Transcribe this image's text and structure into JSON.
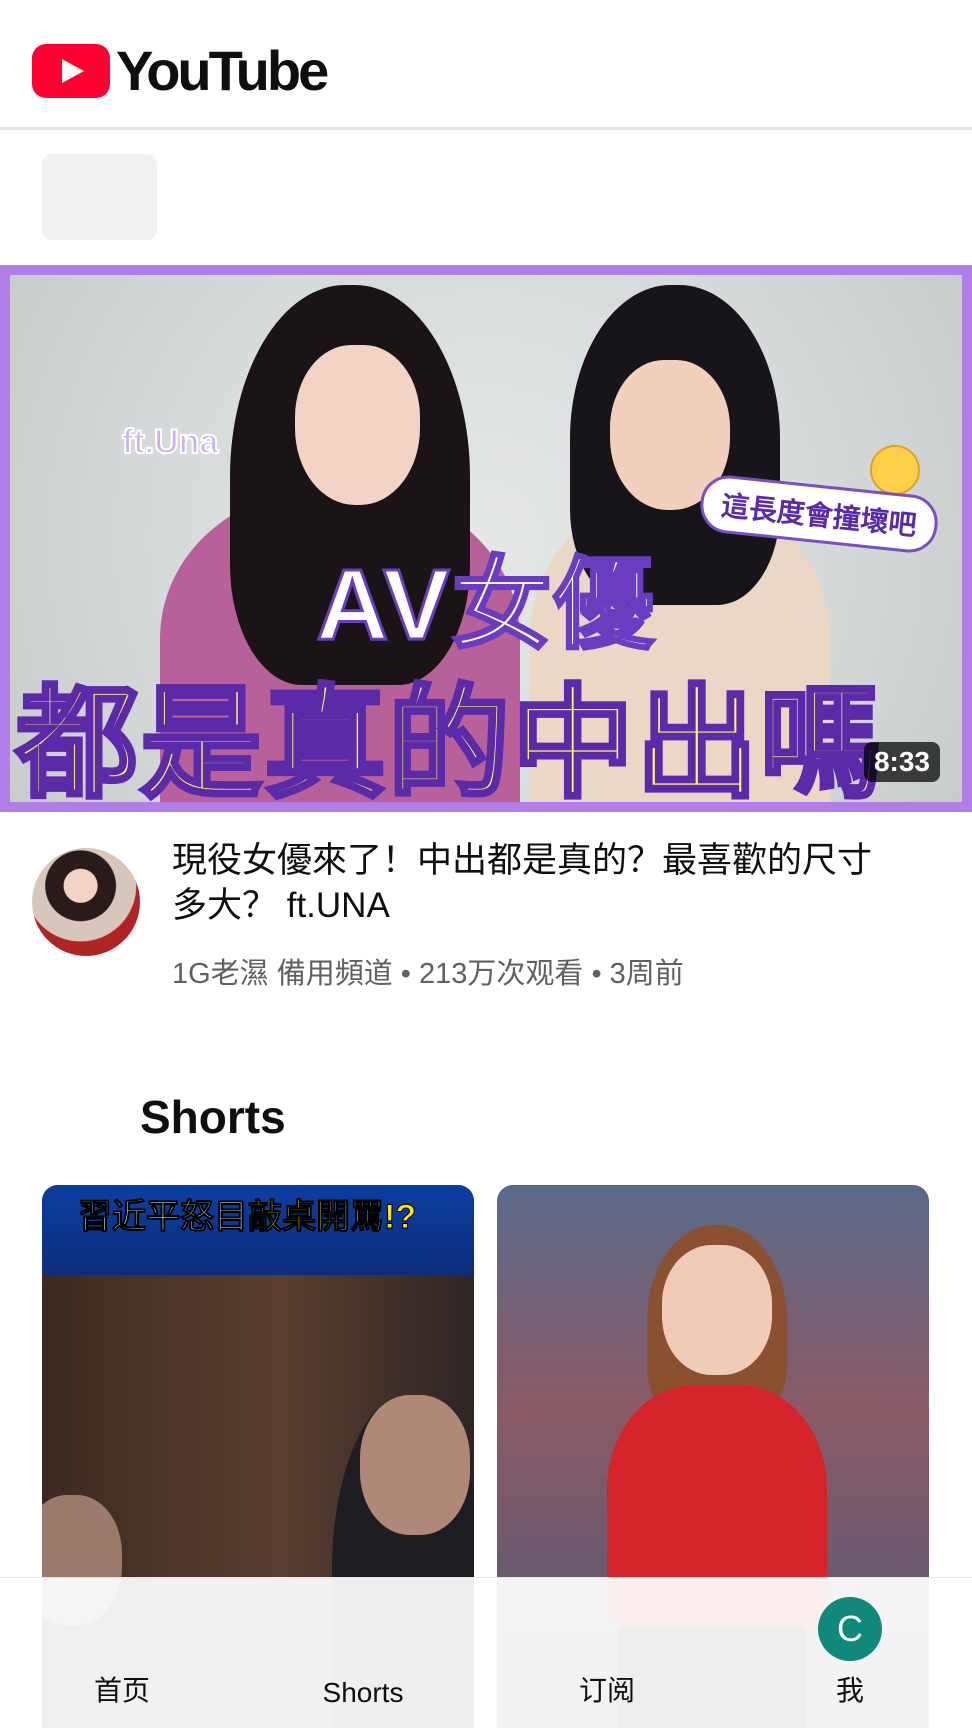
{
  "app": {
    "logo_text": "YouTube"
  },
  "featured_video": {
    "thumbnail_tag": "ft.Una",
    "thumbnail_bubble": "這長度會撞壞吧",
    "thumbnail_line1": "AV女優",
    "thumbnail_line2": "都是真的中出嗎",
    "duration": "8:33",
    "title": "現役女優來了！中出都是真的？最喜歡的尺寸多大？ ft.UNA",
    "channel": "1G老濕 備用頻道",
    "views": "213万次观看",
    "age": "3周前",
    "subtitle": "1G老濕 備用頻道 • 213万次观看 • 3周前"
  },
  "shorts": {
    "header": "Shorts",
    "items": [
      {
        "banner_prefix": "習近平怒目",
        "banner_highlight": "敲桌開罵!?"
      },
      {
        "banner_prefix": "",
        "banner_highlight": ""
      }
    ]
  },
  "bottom_nav": {
    "home": "首页",
    "shorts": "Shorts",
    "subscriptions": "订阅",
    "me": "我",
    "me_initial": "C"
  },
  "colors": {
    "brand_red": "#ff0033",
    "avatar_green": "#10897a",
    "thumbnail_frame": "#b07ee6"
  }
}
